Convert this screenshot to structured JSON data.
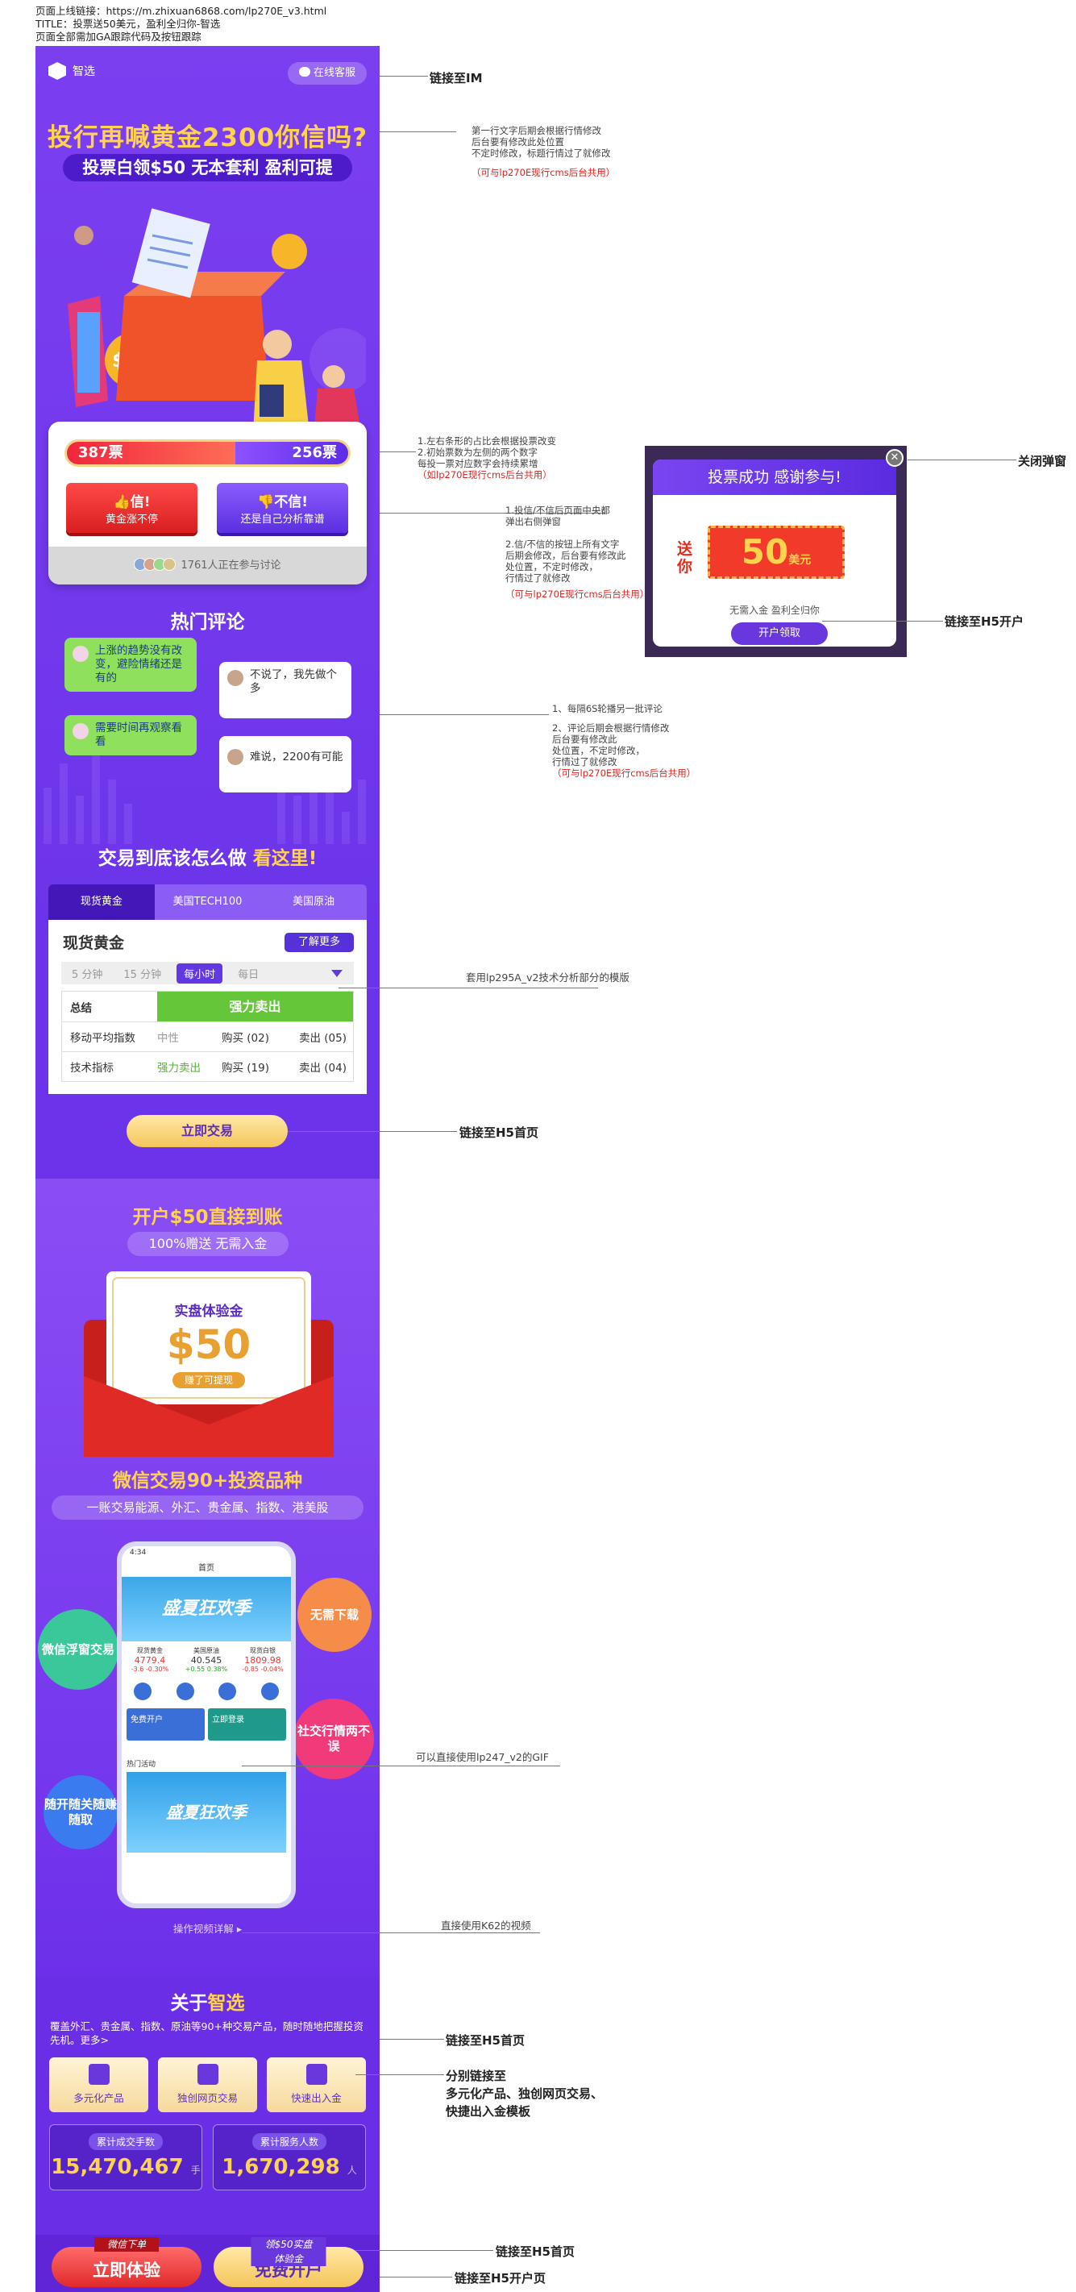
{
  "header": {
    "line1": "页面上线链接：https://m.zhixuan6868.com/lp270E_v3.html",
    "line2": "TITLE：投票送50美元，盈利全归你-智选",
    "line3": "页面全部需加GA跟踪代码及按钮跟踪"
  },
  "topbar": {
    "logo_label": "智选",
    "service_label": "在线客服"
  },
  "hero": {
    "headline": "投行再喊黄金2300你信吗?",
    "subhead": "投票白领$50 无本套利 盈利可提"
  },
  "vote": {
    "bull_count": "387票",
    "bear_count": "256票",
    "bull_share": 0.6,
    "believe_title": "信!",
    "believe_sub": "黄金涨不停",
    "doubt_title": "不信!",
    "doubt_sub": "还是自己分析靠谱",
    "participants": "1761人正在参与讨论"
  },
  "comments": {
    "title": "热门评论",
    "items": [
      "上涨的趋势没有改变，避险情绪还是有的",
      "不说了，我先做个多",
      "需要时间再观察看看",
      "难说，2200有可能"
    ]
  },
  "trade": {
    "title_prefix": "交易到底该怎么做",
    "title_highlight": "看这里!",
    "tabs": [
      "现货黄金",
      "美国TECH100",
      "美国原油"
    ],
    "card_title": "现货黄金",
    "more_label": "了解更多",
    "periods": [
      "5 分钟",
      "15 分钟",
      "每小时",
      "每日"
    ],
    "summary_label": "总结",
    "summary_value": "强力卖出",
    "rows": [
      {
        "name": "移动平均指数",
        "signal": "中性",
        "buy": "购买 (02)",
        "sell": "卖出 (05)"
      },
      {
        "name": "技术指标",
        "signal": "强力卖出",
        "buy": "购买 (19)",
        "sell": "卖出 (04)"
      }
    ],
    "cta": "立即交易"
  },
  "account": {
    "title": "开户$50直接到账",
    "pill": "100%赠送 无需入金",
    "card_title": "实盘体验金",
    "amount": "$50",
    "card_tag": "赚了可提现"
  },
  "products": {
    "title": "微信交易90+投资品种",
    "pill": "一账交易能源、外汇、贵金属、指数、港美股",
    "bubbles": [
      "微信浮窗交易",
      "无需下载",
      "社交行情两不误",
      "随开随关随赚随取"
    ],
    "screen_title": "首页",
    "screen_time": "4:34",
    "banner_text": "盛夏狂欢季",
    "quotes": [
      {
        "name": "现货黄金",
        "value": "4779.4",
        "change": "-3.6 -0.30%"
      },
      {
        "name": "美国原油",
        "value": "40.545",
        "change": "+0.55 0.38%"
      },
      {
        "name": "现货白银",
        "value": "1809.98",
        "change": "-0.85 -0.04%"
      }
    ],
    "promo_left": "免费开户",
    "promo_right": "立即登录",
    "hot_label": "热门活动",
    "video_link": "操作视频详解 ▸"
  },
  "about": {
    "title_prefix": "关于",
    "title_highlight": "智选",
    "desc": "覆盖外汇、贵金属、指数、原油等90+种交易产品，随时随地把握投资先机。更多>",
    "features": [
      "多元化产品",
      "独创网页交易",
      "快速出入金"
    ],
    "stat1_label": "累计成交手数",
    "stat1_value": "15,470,467",
    "stat1_unit": "手",
    "stat2_label": "累计服务人数",
    "stat2_value": "1,670,298",
    "stat2_unit": "人"
  },
  "bottom": {
    "left_tag": "微信下单",
    "left_label": "立即体验",
    "right_tag": "领$50实盘体验金",
    "right_label": "免费开户"
  },
  "modal": {
    "title": "投票成功 感谢参与!",
    "gift": "送你",
    "amount": "50",
    "unit": "美元",
    "note": "无需入金 盈利全归你",
    "button": "开户领取"
  },
  "annotations": {
    "im": "链接至IM",
    "headline_note": [
      "第一行文字后期会根据行情修改",
      "后台要有修改此处位置",
      "不定时修改，标题行情过了就修改"
    ],
    "headline_red": "（可与lp270E现行cms后台共用）",
    "vote_note": [
      "1.左右条形的占比会根据投票改变",
      "2.初始票数为左侧的两个数字",
      "每投一票对应数字会持续累增"
    ],
    "vote_red": "（如lp270E现行cms后台共用）",
    "vote_note2": [
      "1.投信/不信后页面中央都",
      "弹出右侧弹窗"
    ],
    "vote_note3": [
      "2.信/不信的按钮上所有文字",
      "后期会修改，后台要有修改此",
      "处位置，不定时修改，",
      "行情过了就修改"
    ],
    "vote_red2": "（可与lp270E现行cms后台共用）",
    "close_modal": "关闭弹窗",
    "h5_account": "链接至H5开户",
    "comment_note": [
      "1、每隔6S轮播另一批评论",
      "2、评论后期会根据行情修改",
      "后台要有修改此",
      "处位置，不定时修改，",
      "行情过了就修改"
    ],
    "comment_red": "（可与lp270E现行cms后台共用）",
    "tech_note": "套用lp295A_v2技术分析部分的模版",
    "h5_home": "链接至H5首页",
    "gif_note": "可以直接使用lp247_v2的GIF",
    "video_note": "直接使用K62的视频",
    "feature_note": [
      "分别链接至",
      "多元化产品、独创网页交易、",
      "快捷出入金模板"
    ],
    "h5_home2": "链接至H5首页",
    "h5_home3": "链接至H5首页",
    "h5_account2": "链接至H5开户页"
  }
}
